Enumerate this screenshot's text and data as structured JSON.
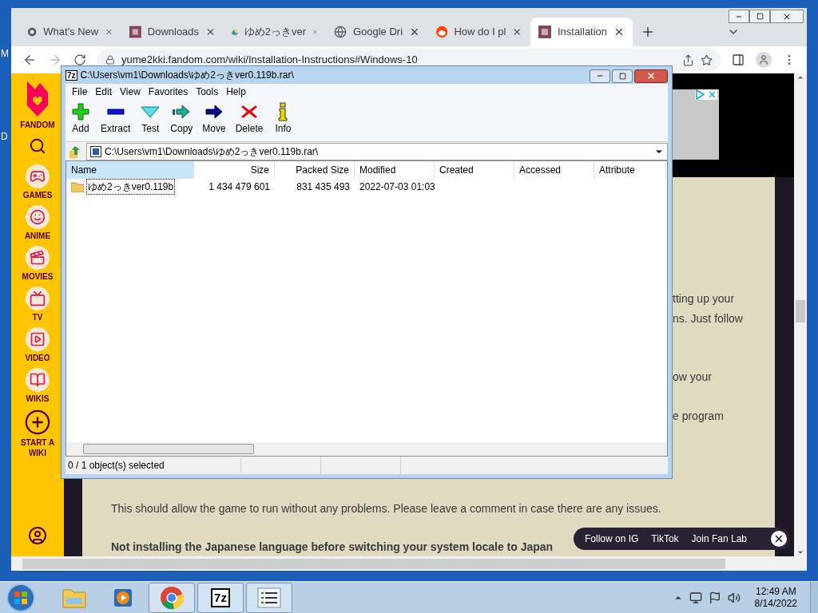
{
  "desktop": {
    "labels": [
      "M",
      "D"
    ]
  },
  "browser": {
    "tabs": [
      {
        "title": "What's New",
        "kind": "chrome",
        "selected": false
      },
      {
        "title": "Downloads",
        "kind": "wiki",
        "selected": false
      },
      {
        "title": "ゆめ2っきver",
        "kind": "drive",
        "selected": false
      },
      {
        "title": "Google Dri",
        "kind": "globe",
        "selected": false
      },
      {
        "title": "How do I pl",
        "kind": "reddit",
        "selected": false
      },
      {
        "title": "Installation",
        "kind": "wiki",
        "selected": true
      }
    ],
    "address": "yume2kki.fandom.com/wiki/Installation-Instructions#Windows-10"
  },
  "fandom_nav": {
    "brand": "FANDOM",
    "items": [
      {
        "label": "GAMES",
        "kind": "games"
      },
      {
        "label": "ANIME",
        "kind": "anime"
      },
      {
        "label": "MOVIES",
        "kind": "movies"
      },
      {
        "label": "TV",
        "kind": "tv"
      },
      {
        "label": "VIDEO",
        "kind": "video"
      },
      {
        "label": "WIKIS",
        "kind": "wikis"
      },
      {
        "label": "START A WIKI",
        "kind": "start"
      }
    ]
  },
  "page": {
    "fragments": [
      "tting up your",
      "ns. Just follow",
      "ow your",
      "e program"
    ],
    "paragraph": "This should allow the game to run without any problems. Please leave a comment in case there are any issues.",
    "bold_paragraph": "Not installing the Japanese language before switching your system locale to Japan",
    "promo_links": [
      "Follow on IG",
      "TikTok",
      "Join Fan Lab"
    ]
  },
  "archive_window": {
    "icon_text": "7z",
    "title": "C:\\Users\\vm1\\Downloads\\ゆめ2っきver0.119b.rar\\",
    "menu": [
      "File",
      "Edit",
      "View",
      "Favorites",
      "Tools",
      "Help"
    ],
    "toolbar": [
      {
        "label": "Add",
        "kind": "add"
      },
      {
        "label": "Extract",
        "kind": "extract"
      },
      {
        "label": "Test",
        "kind": "test"
      },
      {
        "label": "Copy",
        "kind": "copy"
      },
      {
        "label": "Move",
        "kind": "move"
      },
      {
        "label": "Delete",
        "kind": "delete"
      },
      {
        "label": "Info",
        "kind": "info"
      }
    ],
    "path": "C:\\Users\\vm1\\Downloads\\ゆめ2っきver0.119b.rar\\",
    "columns": [
      {
        "label": "Name",
        "selected": true
      },
      {
        "label": "Size",
        "selected": false
      },
      {
        "label": "Packed Size",
        "selected": false
      },
      {
        "label": "Modified",
        "selected": false
      },
      {
        "label": "Created",
        "selected": false
      },
      {
        "label": "Accessed",
        "selected": false
      },
      {
        "label": "Attribute",
        "selected": false
      }
    ],
    "rows": [
      {
        "cells": [
          "ゆめ2っきver0.119b",
          "1 434 479 601",
          "831 435 493",
          "2022-07-03 01:03"
        ]
      }
    ],
    "status": "0 / 1 object(s) selected"
  },
  "taskbar": {
    "items": [
      {
        "kind": "explorer",
        "running": false
      },
      {
        "kind": "media",
        "running": false
      },
      {
        "kind": "chrome",
        "running": true
      },
      {
        "kind": "sevenzip",
        "label": "7z",
        "running": true
      },
      {
        "kind": "list",
        "running": true
      }
    ],
    "time": "12:49 AM",
    "date": "8/14/2022"
  }
}
